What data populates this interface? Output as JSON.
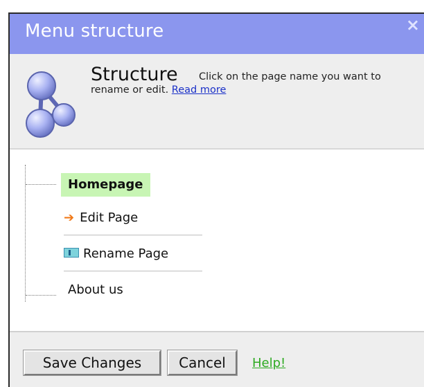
{
  "dialog": {
    "title": "Menu structure",
    "close_glyph": "×"
  },
  "header": {
    "logo_icon": "structure-molecule-icon",
    "title": "Structure",
    "description": "Click on the page name you want to rename or edit.",
    "read_more": "Read more"
  },
  "tree": {
    "selected_page": "Homepage",
    "actions": {
      "edit_label": "Edit Page",
      "edit_icon": "arrow-right-icon",
      "rename_label": "Rename Page",
      "rename_icon": "text-cursor-icon"
    },
    "other_page": "About us"
  },
  "footer": {
    "save_label": "Save Changes",
    "cancel_label": "Cancel",
    "help_label": "Help!"
  },
  "colors": {
    "titlebar": "#8b96ee",
    "selected_bg": "#c8f5b4",
    "arrow": "#f07a1a",
    "link": "#1a30c8",
    "help_link": "#2eaa22"
  }
}
